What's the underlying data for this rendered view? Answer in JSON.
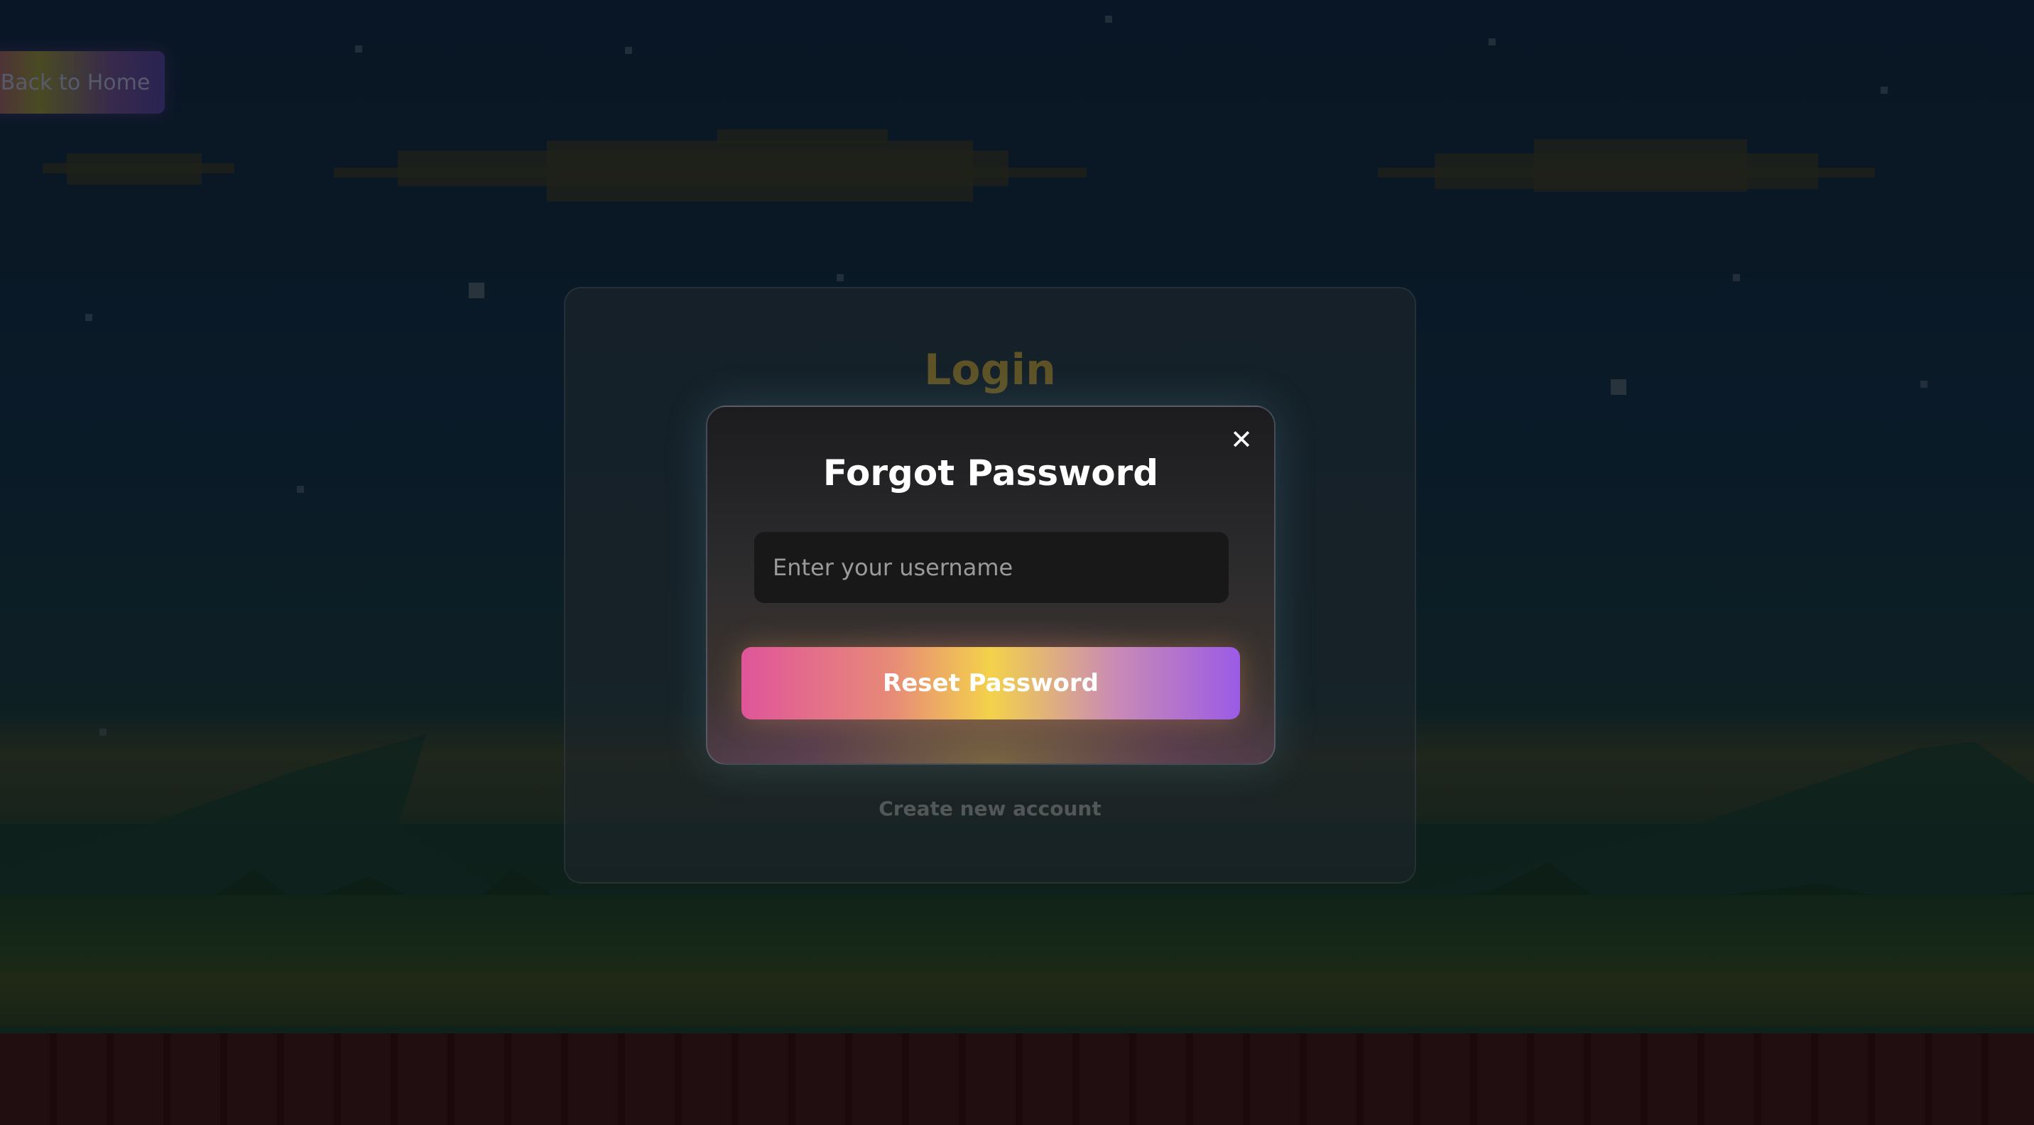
{
  "back_button": {
    "label": "Back to Home"
  },
  "login_card": {
    "title": "Login",
    "create_account_link": "Create new account"
  },
  "forgot_modal": {
    "title": "Forgot Password",
    "close_label": "✕",
    "username_placeholder": "Enter your username",
    "username_value": "",
    "reset_button_label": "Reset Password"
  },
  "colors": {
    "background": "#0d1b2a",
    "login_title": "#7d6a2e",
    "gradient_pink": "#e0559a",
    "gradient_yellow": "#f3d24a",
    "gradient_purple": "#9b5be6"
  },
  "icons": {
    "close": "close-icon"
  }
}
